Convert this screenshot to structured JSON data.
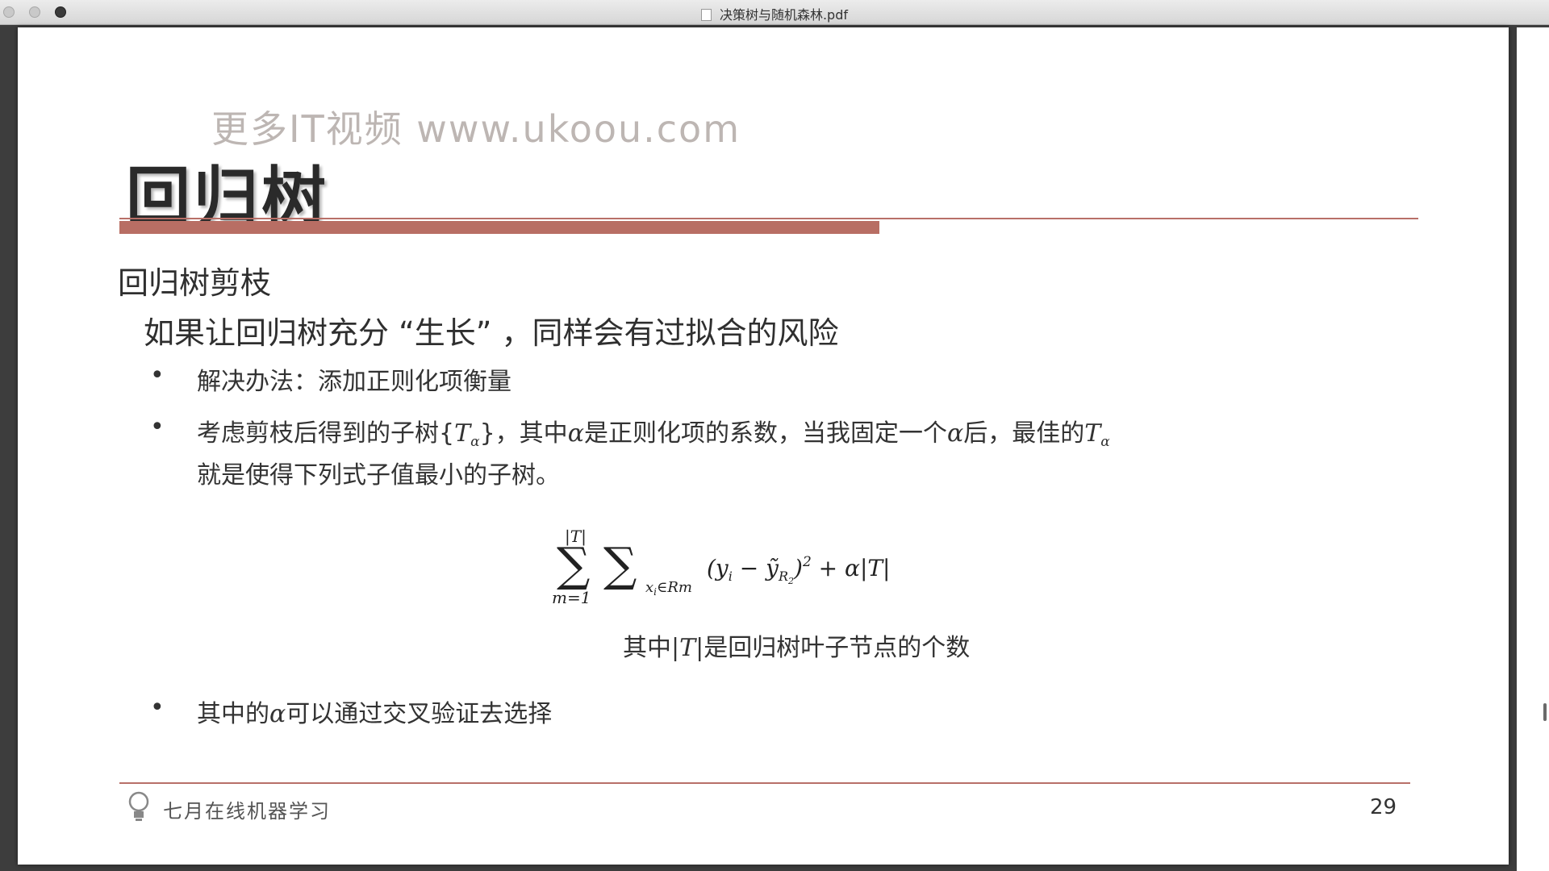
{
  "window": {
    "title": "决策树与随机森林.pdf"
  },
  "watermark": "更多IT视频 www.ukoou.com",
  "slide": {
    "title": "回归树",
    "subheading": "回归树剪枝",
    "lead": "如果让回归树充分 “生长” ，同样会有过拟合的风险",
    "bullets": [
      {
        "text": "解决办法：添加正则化项衡量"
      },
      {
        "part1": "考虑剪枝后得到的子树{",
        "sym_T": "T",
        "sub_alpha": "α",
        "part2": "}，其中",
        "alpha": "α",
        "part3": "是正则化项的系数，当我固定一个",
        "part4": "后，最佳的",
        "line2": "就是使得下列式子值最小的子树。"
      },
      {
        "part1": "其中的",
        "alpha": "α",
        "part2": "可以通过交叉验证去选择"
      }
    ],
    "formula": {
      "upper": "|T|",
      "lower": "m=1",
      "inner_sub": "x",
      "inner_sub_i": "i",
      "inner_sub_rest": "∈Rm",
      "body": "(y",
      "body_i": "i",
      "minus": " − ỹ",
      "body_R": "R",
      "body_2": "2",
      "tail": ")",
      "sq": "2",
      "plus": " + α|T|"
    },
    "formula_caption": {
      "part1": "其中",
      "sym": "|T|",
      "part2": "是回归树叶子节点的个数"
    },
    "footer": {
      "org": "七月在线机器学习",
      "page_number": "29"
    }
  }
}
